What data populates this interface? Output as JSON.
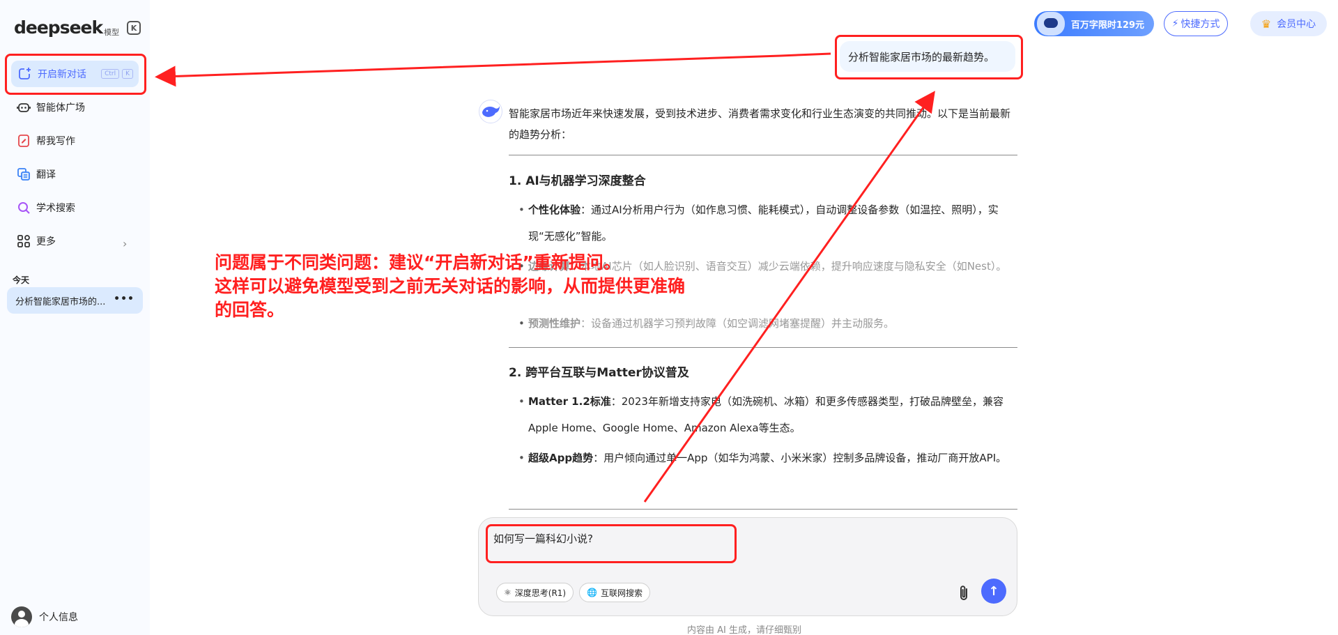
{
  "sidebar": {
    "logo_text": "deepseek",
    "logo_sub": "模型",
    "collapse_glyph": "K",
    "new_chat": {
      "label": "开启新对话",
      "kbd": [
        "Ctrl",
        "K"
      ]
    },
    "items": [
      {
        "label": "智能体广场",
        "icon": "robot-icon"
      },
      {
        "label": "帮我写作",
        "icon": "pen-icon"
      },
      {
        "label": "翻译",
        "icon": "translate-icon"
      },
      {
        "label": "学术搜索",
        "icon": "search-icon"
      },
      {
        "label": "更多",
        "icon": "grid-icon"
      }
    ],
    "more_chevron": "›",
    "section_today": "今天",
    "history": [
      {
        "title": "分析智能家居市场的...",
        "menu": "•••"
      }
    ],
    "profile_label": "个人信息"
  },
  "topbar": {
    "promo_label": "百万字限时129元",
    "shortcut_label": "快捷方式",
    "member_label": "会员中心",
    "bolt_glyph": "⚡",
    "crown_glyph": "♛"
  },
  "chat": {
    "user_message": "分析智能家居市场的最新趋势。",
    "ai_intro": "智能家居市场近年来快速发展，受到技术进步、消费者需求变化和行业生态演变的共同推动。以下是当前最新的趋势分析：",
    "sections": [
      {
        "heading": "1. AI与机器学习深度整合",
        "bullets": [
          {
            "bold": "个性化体验",
            "text": "：通过AI分析用户行为（如作息习惯、能耗模式），自动调整设备参数（如温控、照明），实现“无感化”智能。"
          },
          {
            "bold": "边缘计算",
            "text": "：本地AI芯片（如人脸识别、语音交互）减少云端依赖，提升响应速度与隐私安全（如Nest）。"
          },
          {
            "bold": "预测性维护",
            "text": "：设备通过机器学习预判故障（如空调滤网堵塞提醒）并主动服务。"
          }
        ]
      },
      {
        "heading": "2. 跨平台互联与Matter协议普及",
        "bullets": [
          {
            "bold": "Matter 1.2标准",
            "text": "：2023年新增支持家电（如洗碗机、冰箱）和更多传感器类型，打破品牌壁垒，兼容Apple Home、Google Home、Amazon Alexa等生态。"
          },
          {
            "bold": "超级App趋势",
            "text": "：用户倾向通过单一App（如华为鸿蒙、小米米家）控制多品牌设备，推动厂商开放API。"
          }
        ]
      }
    ]
  },
  "composer": {
    "input_value": "如何写一篇科幻小说?",
    "deep_think_label": "深度思考(R1)",
    "web_search_label": "互联网搜索",
    "send_glyph": "↑",
    "disclaimer": "内容由 AI 生成，请仔细甄别"
  },
  "annotation": {
    "lines": [
      "问题属于不同类问题：建议“开启新对话”重新提问。",
      "这样可以避免模型受到之前无关对话的影响，从而提供更准确",
      "的回答。"
    ],
    "color": "#ff2020"
  },
  "colors": {
    "accent": "#4d6bfe",
    "sidebar_bg": "#f9fbff",
    "highlight": "#dbeafe"
  }
}
